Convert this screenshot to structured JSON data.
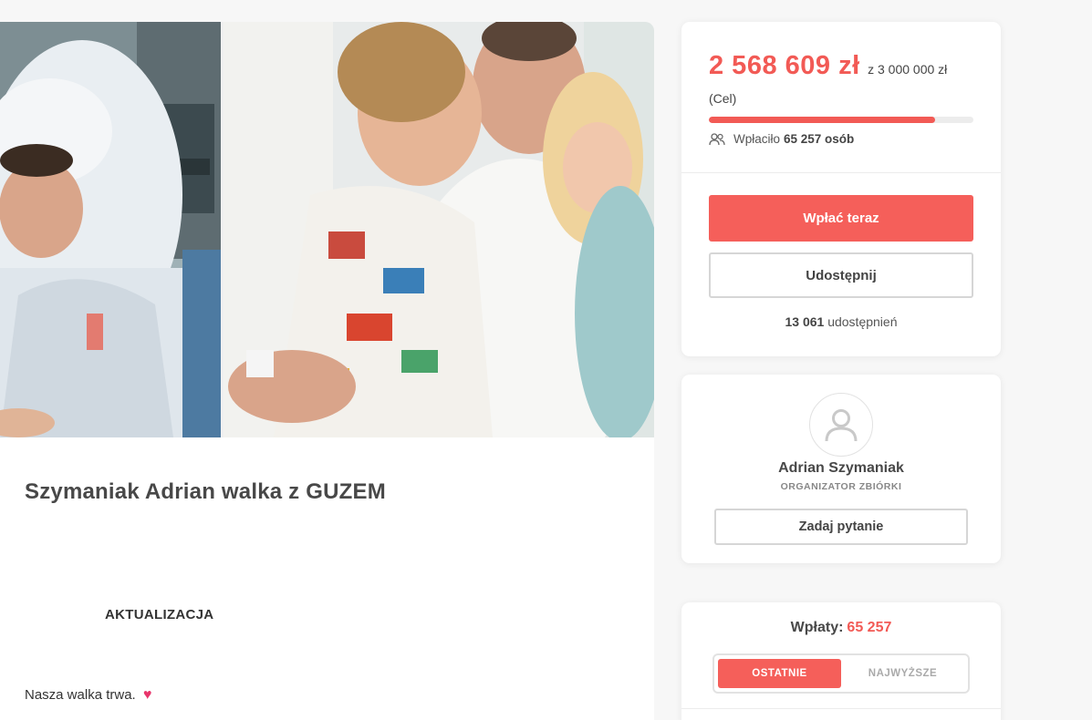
{
  "campaign": {
    "title": "Szymaniak Adrian walka z GUZEM",
    "update_label": "AKTUALIZACJA",
    "story_text": "Nasza walka trwa.",
    "story_emoji": "♥"
  },
  "fundraising": {
    "amount_raised": "2 568 609 zł",
    "goal_text": "z 3 000 000 zł",
    "goal_suffix": "(Cel)",
    "progress_percent": 85.6,
    "donors_label": "Wpłaciło",
    "donors_count": "65 257 osób",
    "donate_button": "Wpłać teraz",
    "share_button": "Udostępnij",
    "shares_count": "13 061",
    "shares_label": "udostępnień"
  },
  "organizer": {
    "name": "Adrian Szymaniak",
    "role": "ORGANIZATOR ZBIÓRKI",
    "ask_button": "Zadaj pytanie"
  },
  "payments": {
    "title_label": "Wpłaty:",
    "count": "65 257",
    "tabs": [
      {
        "label": "OSTATNIE",
        "active": true
      },
      {
        "label": "NAJWYŻSZE",
        "active": false
      }
    ]
  },
  "colors": {
    "accent": "#f55f5a",
    "amount": "#f25a55"
  }
}
